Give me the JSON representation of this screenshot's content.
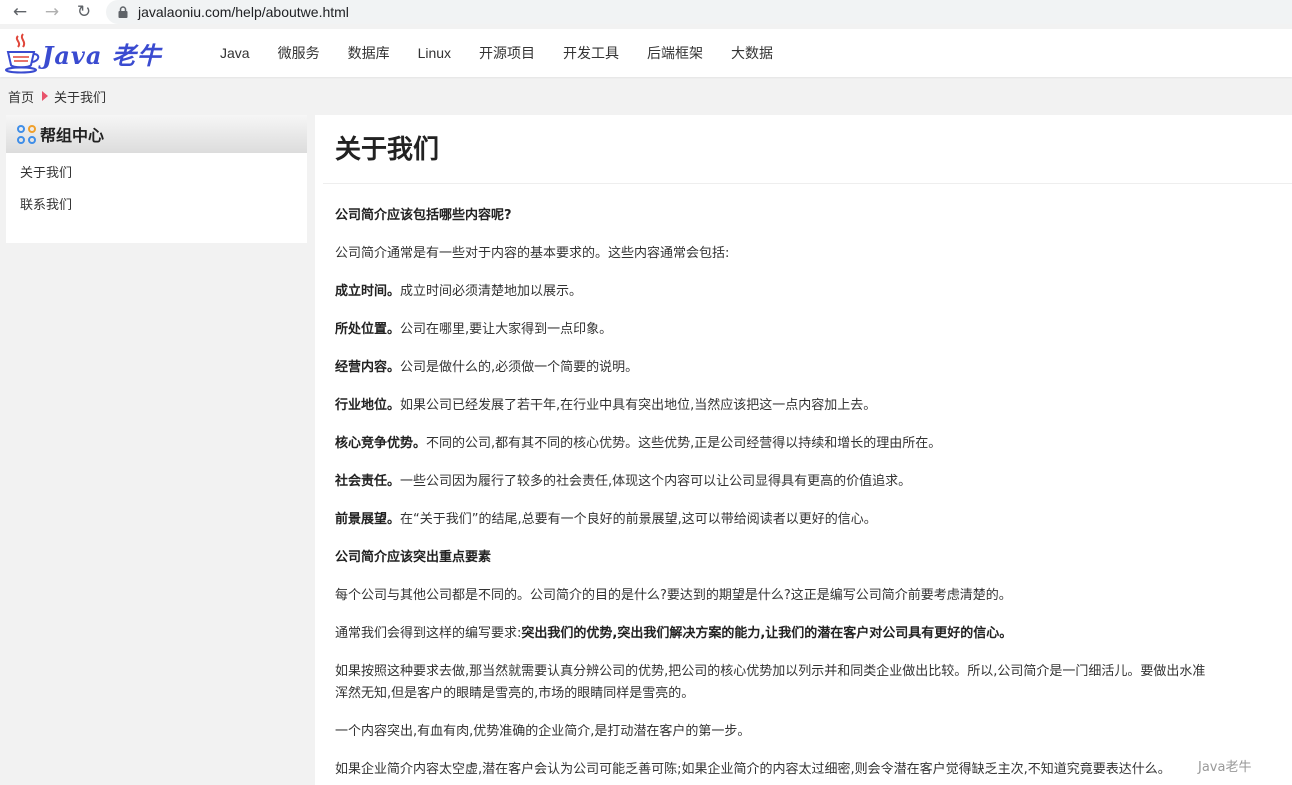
{
  "browser": {
    "url": "javalaoniu.com/help/aboutwe.html"
  },
  "site": {
    "logo_text": "Java 老牛",
    "nav": [
      "Java",
      "微服务",
      "数据库",
      "Linux",
      "开源项目",
      "开发工具",
      "后端框架",
      "大数据"
    ]
  },
  "breadcrumb": {
    "home": "首页",
    "current": "关于我们"
  },
  "sidebar": {
    "title": "帮组中心",
    "items": [
      "关于我们",
      "联系我们"
    ]
  },
  "article": {
    "title": "关于我们",
    "heading1": "公司简介应该包括哪些内容呢?",
    "intro": "公司简介通常是有一些对于内容的基本要求的。这些内容通常会包括:",
    "points": [
      {
        "label": "成立时间。",
        "text": "成立时间必须清楚地加以展示。"
      },
      {
        "label": "所处位置。",
        "text": "公司在哪里,要让大家得到一点印象。"
      },
      {
        "label": "经营内容。",
        "text": "公司是做什么的,必须做一个简要的说明。"
      },
      {
        "label": "行业地位。",
        "text": "如果公司已经发展了若干年,在行业中具有突出地位,当然应该把这一点内容加上去。"
      },
      {
        "label": "核心竞争优势。",
        "text": "不同的公司,都有其不同的核心优势。这些优势,正是公司经营得以持续和增长的理由所在。"
      },
      {
        "label": "社会责任。",
        "text": "一些公司因为履行了较多的社会责任,体现这个内容可以让公司显得具有更高的价值追求。"
      },
      {
        "label": "前景展望。",
        "text": "在“关于我们”的结尾,总要有一个良好的前景展望,这可以带给阅读者以更好的信心。"
      }
    ],
    "heading2": "公司简介应该突出重点要素",
    "para1": "每个公司与其他公司都是不同的。公司简介的目的是什么?要达到的期望是什么?这正是编写公司简介前要考虑清楚的。",
    "para2_prefix": "通常我们会得到这样的编写要求:",
    "para2_bold": "突出我们的优势,突出我们解决方案的能力,让我们的潜在客户对公司具有更好的信心。",
    "para3_line1": "如果按照这种要求去做,那当然就需要认真分辨公司的优势,把公司的核心优势加以列示并和同类企业做出比较。所以,公司简介是一门细活儿。要做出水准",
    "para3_line2": "浑然无知,但是客户的眼睛是雪亮的,市场的眼睛同样是雪亮的。",
    "para4": "一个内容突出,有血有肉,优势准确的企业简介,是打动潜在客户的第一步。",
    "para5": "如果企业简介内容太空虚,潜在客户会认为公司可能乏善可陈;如果企业简介的内容太过细密,则会令潜在客户觉得缺乏主次,不知道究竟要表达什么。"
  },
  "watermark": "Java老牛"
}
